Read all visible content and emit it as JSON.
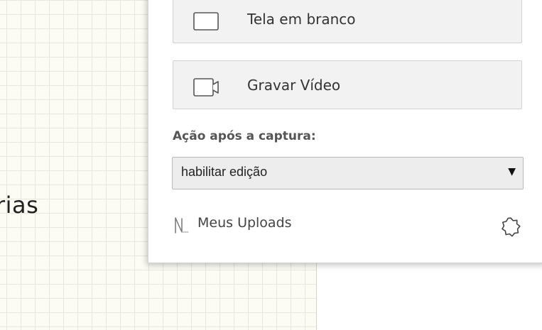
{
  "background": {
    "partial_text": "rias"
  },
  "panel": {
    "blank_screen": {
      "label": "Tela em branco",
      "icon": "blank-screen-icon"
    },
    "record_video": {
      "label": "Gravar Vídeo",
      "icon": "video-camera-icon"
    },
    "after_capture": {
      "label": "Ação após a captura:",
      "selected": "habilitar edição",
      "arrow": "▼"
    },
    "uploads": {
      "label": "Meus Uploads",
      "icon": "uploads-logo-icon"
    },
    "settings": {
      "icon": "gear-icon"
    }
  }
}
